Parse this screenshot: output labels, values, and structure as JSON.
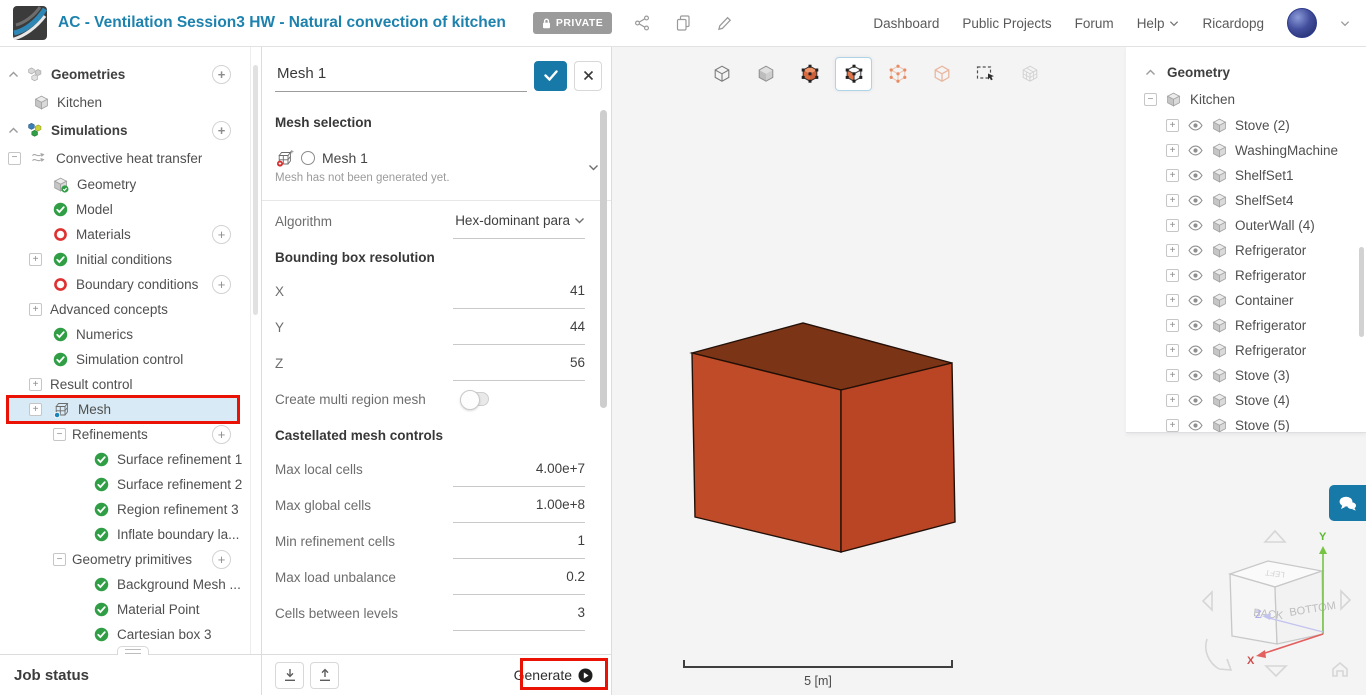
{
  "topbar": {
    "title": "AC - Ventilation Session3 HW - Natural convection of kitchen",
    "private_label": "PRIVATE",
    "nav": [
      "Dashboard",
      "Public Projects",
      "Forum",
      "Help",
      "Ricardopg"
    ]
  },
  "left_tree": {
    "items": [
      {
        "label": "Geometries",
        "kind": "root",
        "icon": "cubes",
        "chevron": true,
        "add": true
      },
      {
        "label": "Kitchen",
        "kind": "geochild",
        "icon": "cube"
      },
      {
        "label": "Simulations",
        "kind": "root",
        "icon": "sim",
        "chevron": true,
        "add": true
      },
      {
        "label": "Convective heat transfer",
        "kind": "simroot",
        "icon": "flow",
        "expander": "minus"
      },
      {
        "label": "Geometry",
        "kind": "child",
        "icon": "cubecheck"
      },
      {
        "label": "Model",
        "kind": "child",
        "icon": "check"
      },
      {
        "label": "Materials",
        "kind": "child",
        "icon": "ring",
        "add": true
      },
      {
        "label": "Initial conditions",
        "kind": "child",
        "icon": "check",
        "expander": "plus"
      },
      {
        "label": "Boundary conditions",
        "kind": "child",
        "icon": "ring",
        "add": true
      },
      {
        "label": "Advanced concepts",
        "kind": "childni",
        "expander": "plus"
      },
      {
        "label": "Numerics",
        "kind": "child",
        "icon": "check"
      },
      {
        "label": "Simulation control",
        "kind": "child",
        "icon": "check"
      },
      {
        "label": "Result control",
        "kind": "childni",
        "expander": "plus"
      },
      {
        "label": "Mesh",
        "kind": "child",
        "icon": "mesh",
        "expander": "plus",
        "highlight": true,
        "annotated": true
      },
      {
        "label": "Refinements",
        "kind": "sub",
        "expander": "minus",
        "add": true
      },
      {
        "label": "Surface refinement 1",
        "kind": "subchild",
        "icon": "check"
      },
      {
        "label": "Surface refinement 2",
        "kind": "subchild",
        "icon": "check"
      },
      {
        "label": "Region refinement 3",
        "kind": "subchild",
        "icon": "check"
      },
      {
        "label": "Inflate boundary la...",
        "kind": "subchild",
        "icon": "check"
      },
      {
        "label": "Geometry primitives",
        "kind": "sub",
        "expander": "minus",
        "add": true
      },
      {
        "label": "Background Mesh ...",
        "kind": "subchild",
        "icon": "check"
      },
      {
        "label": "Material Point",
        "kind": "subchild",
        "icon": "check"
      },
      {
        "label": "Cartesian box 3",
        "kind": "subchild",
        "icon": "check"
      }
    ]
  },
  "job_status": {
    "label": "Job status"
  },
  "panel": {
    "name_value": "Mesh 1",
    "fields": [
      {
        "type": "heading",
        "label": "Mesh selection"
      },
      {
        "type": "mesh-select",
        "value": "Mesh 1",
        "note": "Mesh has not been generated yet."
      },
      {
        "type": "divider"
      },
      {
        "type": "select",
        "label": "Algorithm",
        "value": "Hex-dominant para"
      },
      {
        "type": "heading",
        "label": "Bounding box resolution"
      },
      {
        "type": "input",
        "label": "X",
        "value": "41"
      },
      {
        "type": "input",
        "label": "Y",
        "value": "44"
      },
      {
        "type": "input",
        "label": "Z",
        "value": "56"
      },
      {
        "type": "toggle",
        "label": "Create multi region mesh",
        "value": "off"
      },
      {
        "type": "heading",
        "label": "Castellated mesh controls"
      },
      {
        "type": "input",
        "label": "Max local cells",
        "value": "4.00e+7"
      },
      {
        "type": "input",
        "label": "Max global cells",
        "value": "1.00e+8"
      },
      {
        "type": "input",
        "label": "Min refinement cells",
        "value": "1"
      },
      {
        "type": "input",
        "label": "Max load unbalance",
        "value": "0.2"
      },
      {
        "type": "input",
        "label": "Cells between levels",
        "value": "3"
      }
    ],
    "footer": {
      "generate_label": "Generate"
    }
  },
  "viewport": {
    "toolbar": [
      {
        "name": "wireframe-view"
      },
      {
        "name": "solid-view"
      },
      {
        "name": "solid-vertices-view",
        "selected": false
      },
      {
        "name": "face-select",
        "selected": true
      },
      {
        "name": "vertex-select"
      },
      {
        "name": "edge-select"
      },
      {
        "name": "box-select"
      },
      {
        "name": "mesh-view",
        "disabled": true
      }
    ],
    "scale_label": "5 [m]",
    "navcube": {
      "back": "BACK",
      "bottom": "BOTTOM",
      "left": "LEFT",
      "x": "X",
      "y": "Y",
      "z": "Z"
    }
  },
  "right_tree": {
    "header": "Geometry",
    "root": "Kitchen",
    "items": [
      "Stove (2)",
      "WashingMachine",
      "ShelfSet1",
      "ShelfSet4",
      "OuterWall (4)",
      "Refrigerator",
      "Refrigerator",
      "Container",
      "Refrigerator",
      "Refrigerator",
      "Stove (3)",
      "Stove (4)",
      "Stove (5)"
    ]
  },
  "colors": {
    "accent": "#1779a8",
    "annotation_red": "#ea1205",
    "box_left": "#c04b28",
    "box_right": "#ba4525",
    "box_top": "#7c3417",
    "check_green": "#2f9e44",
    "ring_red": "#e03131",
    "highlight_blue": "#d8eaf5"
  }
}
